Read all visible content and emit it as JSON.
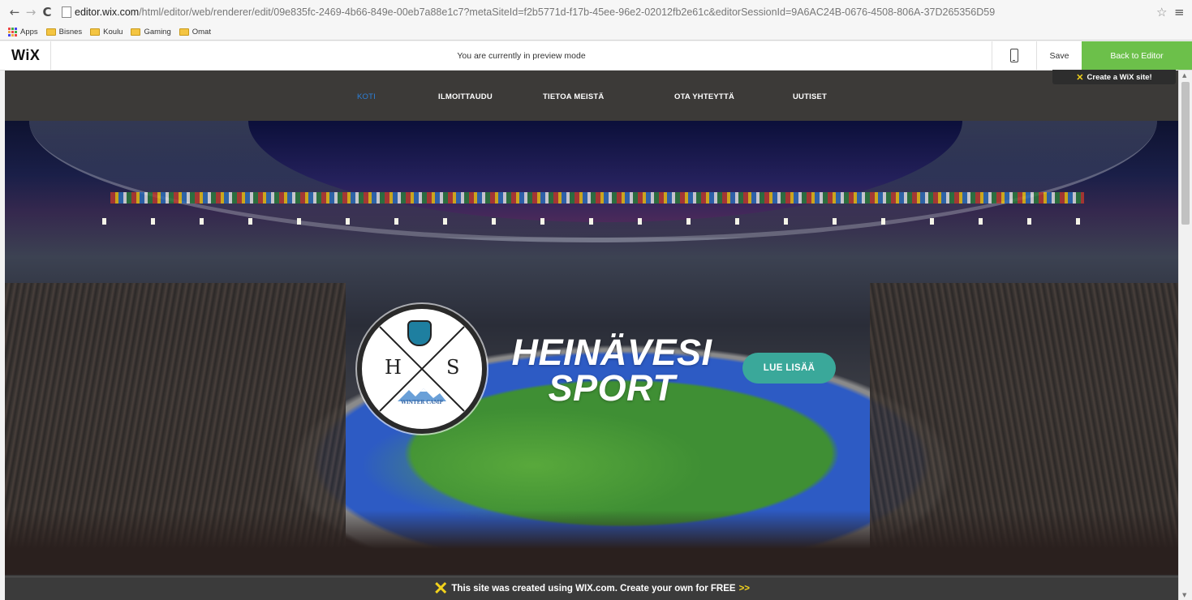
{
  "browser": {
    "url_host": "editor.wix.com",
    "url_rest": "/html/editor/web/renderer/edit/09e835fc-2469-4b66-849e-00eb7a88e1c7?metaSiteId=f2b5771d-f17b-45ee-96e2-02012fb2e61c&editorSessionId=9A6AC24B-0676-4508-806A-37D265356D59",
    "bookmarks": [
      "Apps",
      "Bisnes",
      "Koulu",
      "Gaming",
      "Omat"
    ],
    "icons": {
      "back": "back-arrow-icon",
      "forward": "forward-arrow-icon",
      "reload": "reload-icon",
      "star": "star-icon",
      "menu": "menu-icon"
    }
  },
  "wix_bar": {
    "logo": "WiX",
    "preview_message": "You are currently in preview mode",
    "save_label": "Save",
    "back_label": "Back to Editor",
    "accent_color": "#6cc04a"
  },
  "site": {
    "nav": [
      "KOTI",
      "ILMOITTAUDU",
      "TIETOA MEISTÄ",
      "OTA YHTEYTTÄ",
      "UUTISET"
    ],
    "active_nav": "KOTI",
    "create_badge": "Create a WiX site!",
    "hero": {
      "title_line1": "HEINÄVESI",
      "title_line2": "SPORT",
      "cta_label": "LUE LISÄÄ",
      "logo_left": "H",
      "logo_right": "S",
      "logo_caption": "WINTER CAMP"
    },
    "footer_banner": {
      "text": "This site was created using WIX.com. Create your own for FREE",
      "arrow": ">>"
    }
  }
}
